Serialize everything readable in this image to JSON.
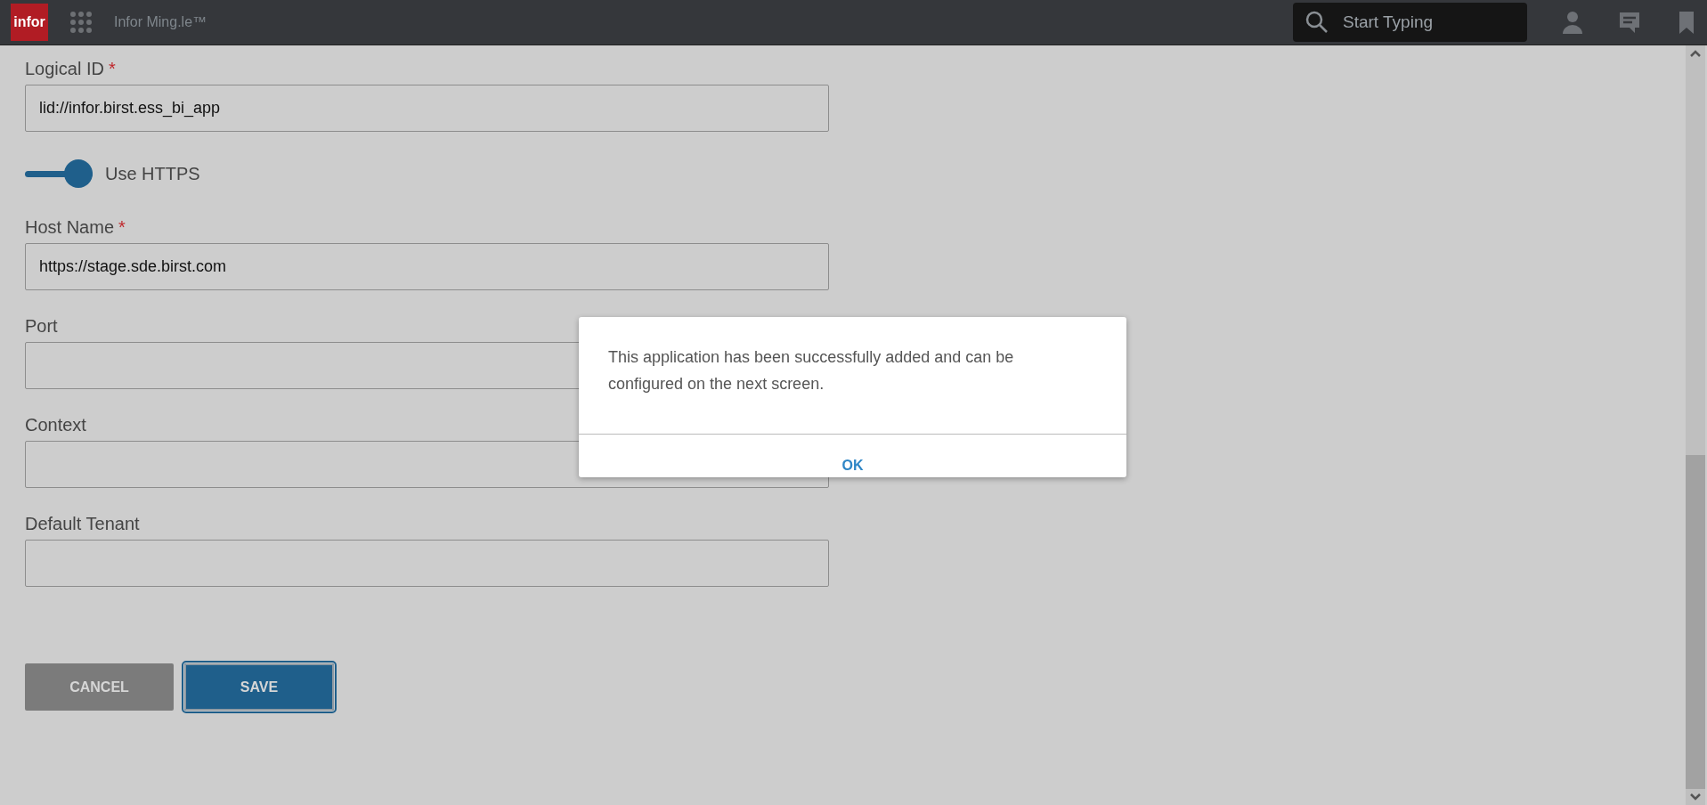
{
  "top_bar": {
    "logo": "infor",
    "app_title": "Infor Ming.le™",
    "search": {
      "placeholder": "Start Typing"
    }
  },
  "form": {
    "fields": [
      {
        "kind": "text",
        "label": "Logical ID",
        "required_mark": "*",
        "value": "lid://infor.birst.ess_bi_app"
      },
      {
        "kind": "toggle",
        "label": "Use HTTPS",
        "on": true
      },
      {
        "kind": "text",
        "label": "Host Name",
        "required_mark": "*",
        "value": "https://stage.sde.birst.com"
      },
      {
        "kind": "text",
        "label": "Port"
      },
      {
        "kind": "text",
        "label": "Context"
      },
      {
        "kind": "text",
        "label": "Default Tenant"
      }
    ],
    "buttons": [
      {
        "label": "CANCEL",
        "kind": "secondary"
      },
      {
        "label": "SAVE",
        "kind": "primary"
      }
    ]
  },
  "dialog": {
    "message": "This application has been successfully added and can be configured on the next screen.",
    "button": "OK"
  }
}
